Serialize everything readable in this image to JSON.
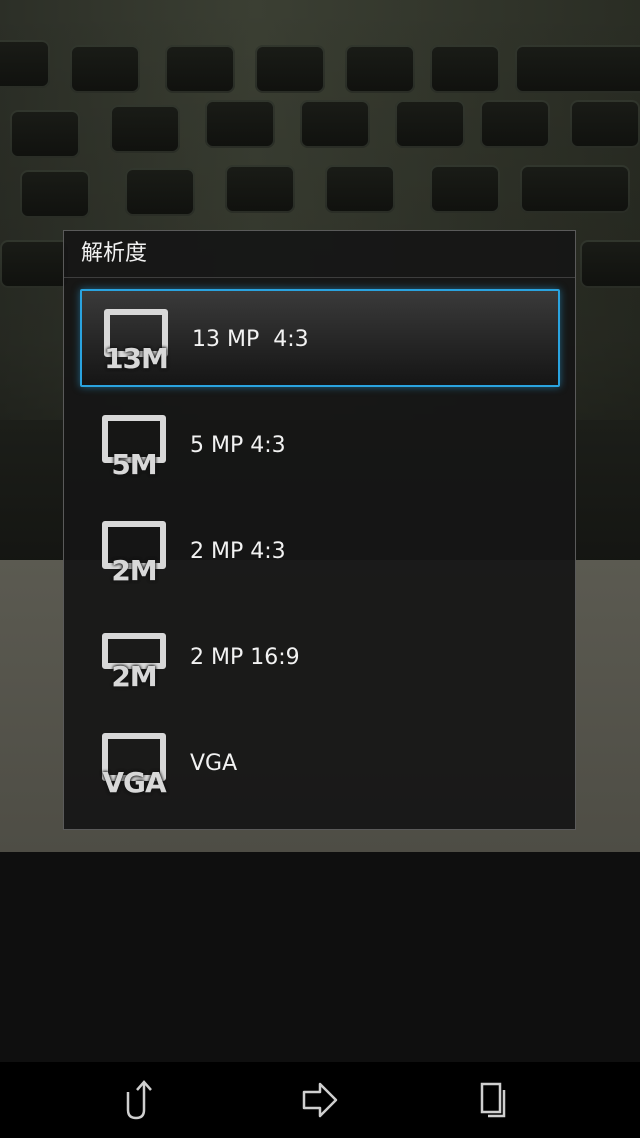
{
  "dialog": {
    "title": "解析度",
    "options": [
      {
        "icon_text": "13M",
        "label": "13 MP  4:3",
        "selected": true,
        "icon": "resolution-icon"
      },
      {
        "icon_text": "5M",
        "label": "5 MP 4:3",
        "selected": false,
        "icon": "resolution-icon"
      },
      {
        "icon_text": "2M",
        "label": "2 MP 4:3",
        "selected": false,
        "icon": "resolution-icon"
      },
      {
        "icon_text": "2M",
        "label": "2 MP 16:9",
        "selected": false,
        "icon": "resolution-wide-icon"
      },
      {
        "icon_text": "VGA",
        "label": "VGA",
        "selected": false,
        "icon": "resolution-icon"
      }
    ]
  },
  "navbar": {
    "buttons": [
      {
        "name": "back-button",
        "icon": "back-arrow-icon"
      },
      {
        "name": "home-button",
        "icon": "home-arrow-icon"
      },
      {
        "name": "recent-apps-button",
        "icon": "recent-apps-icon"
      }
    ]
  },
  "colors": {
    "accent": "#2aa3df",
    "dialog_bg": "#161616",
    "text": "#f2f2f2"
  }
}
